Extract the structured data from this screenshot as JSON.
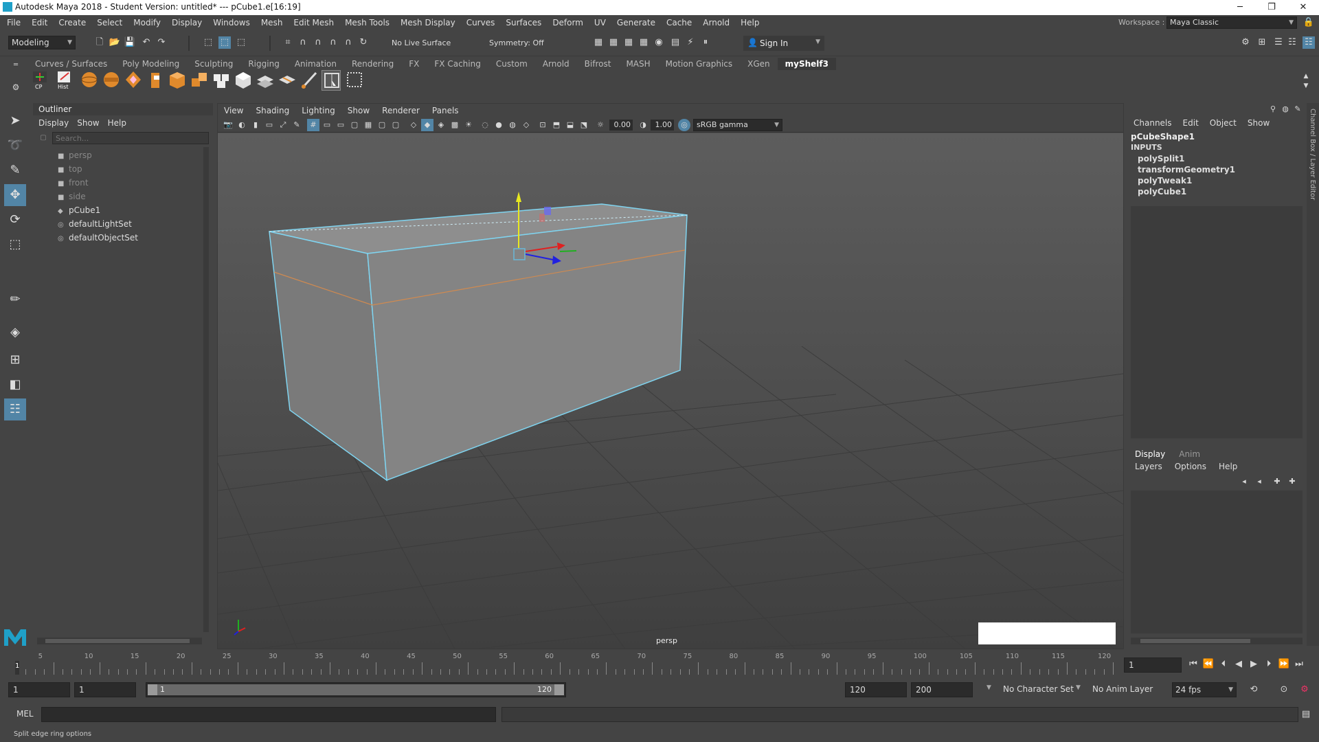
{
  "window": {
    "title": "Autodesk Maya 2018 - Student Version: untitled*   ---   pCube1.e[16:19]",
    "minimize": "─",
    "maximize": "❐",
    "close": "✕"
  },
  "menubar": {
    "items": [
      "File",
      "Edit",
      "Create",
      "Select",
      "Modify",
      "Display",
      "Windows",
      "Mesh",
      "Edit Mesh",
      "Mesh Tools",
      "Mesh Display",
      "Curves",
      "Surfaces",
      "Deform",
      "UV",
      "Generate",
      "Cache",
      "Arnold",
      "Help"
    ],
    "workspace_label": "Workspace :",
    "workspace_value": "Maya Classic"
  },
  "statusline": {
    "mode": "Modeling",
    "live_surface": "No Live Surface",
    "symmetry": "Symmetry: Off",
    "sign_in": "Sign In"
  },
  "shelf": {
    "tabs": [
      "Curves / Surfaces",
      "Poly Modeling",
      "Sculpting",
      "Rigging",
      "Animation",
      "Rendering",
      "FX",
      "FX Caching",
      "Custom",
      "Arnold",
      "Bifrost",
      "MASH",
      "Motion Graphics",
      "XGen",
      "myShelf3"
    ],
    "active_tab": "myShelf3",
    "cp_label": "CP",
    "hist_label": "Hist"
  },
  "outliner": {
    "title": "Outliner",
    "menu": [
      "Display",
      "Show",
      "Help"
    ],
    "search_placeholder": "Search...",
    "items": [
      {
        "label": "persp",
        "icon": "camera-icon",
        "dim": true
      },
      {
        "label": "top",
        "icon": "camera-icon",
        "dim": true
      },
      {
        "label": "front",
        "icon": "camera-icon",
        "dim": true
      },
      {
        "label": "side",
        "icon": "camera-icon",
        "dim": true
      },
      {
        "label": "pCube1",
        "icon": "mesh-icon",
        "dim": false
      },
      {
        "label": "defaultLightSet",
        "icon": "set-icon",
        "dim": false
      },
      {
        "label": "defaultObjectSet",
        "icon": "set-icon",
        "dim": false
      }
    ]
  },
  "viewport": {
    "menu": [
      "View",
      "Shading",
      "Lighting",
      "Show",
      "Renderer",
      "Panels"
    ],
    "exposure": "0.00",
    "gamma": "1.00",
    "color_space": "sRGB gamma",
    "camera_label": "persp"
  },
  "channelbox": {
    "menu": [
      "Channels",
      "Edit",
      "Object",
      "Show"
    ],
    "shape": "pCubeShape1",
    "inputs_label": "INPUTS",
    "inputs": [
      "polySplit1",
      "transformGeometry1",
      "polyTweak1",
      "polyCube1"
    ],
    "side_label": "Channel Box / Layer Editor"
  },
  "layers": {
    "tabs": [
      "Display",
      "Anim"
    ],
    "active_tab": "Display",
    "menu": [
      "Layers",
      "Options",
      "Help"
    ]
  },
  "timeline": {
    "ticks": [
      "5",
      "10",
      "15",
      "20",
      "25",
      "30",
      "35",
      "40",
      "45",
      "50",
      "55",
      "60",
      "65",
      "70",
      "75",
      "80",
      "85",
      "90",
      "95",
      "100",
      "105",
      "110",
      "115",
      "120"
    ],
    "first_tick": "1",
    "current_frame": "1",
    "range_start": "1",
    "playback_start": "1",
    "slider_start": "1",
    "slider_end": "120",
    "playback_end": "120",
    "range_end": "200",
    "character_set": "No Character Set",
    "anim_layer": "No Anim Layer",
    "fps": "24 fps"
  },
  "mel": {
    "label": "MEL"
  },
  "helpline": {
    "text": "Split edge ring options"
  },
  "colors": {
    "accent": "#5285a6",
    "selection_edge": "#7fd4f0",
    "split_edge": "#d08a50",
    "viewport_bg": "#505050"
  }
}
